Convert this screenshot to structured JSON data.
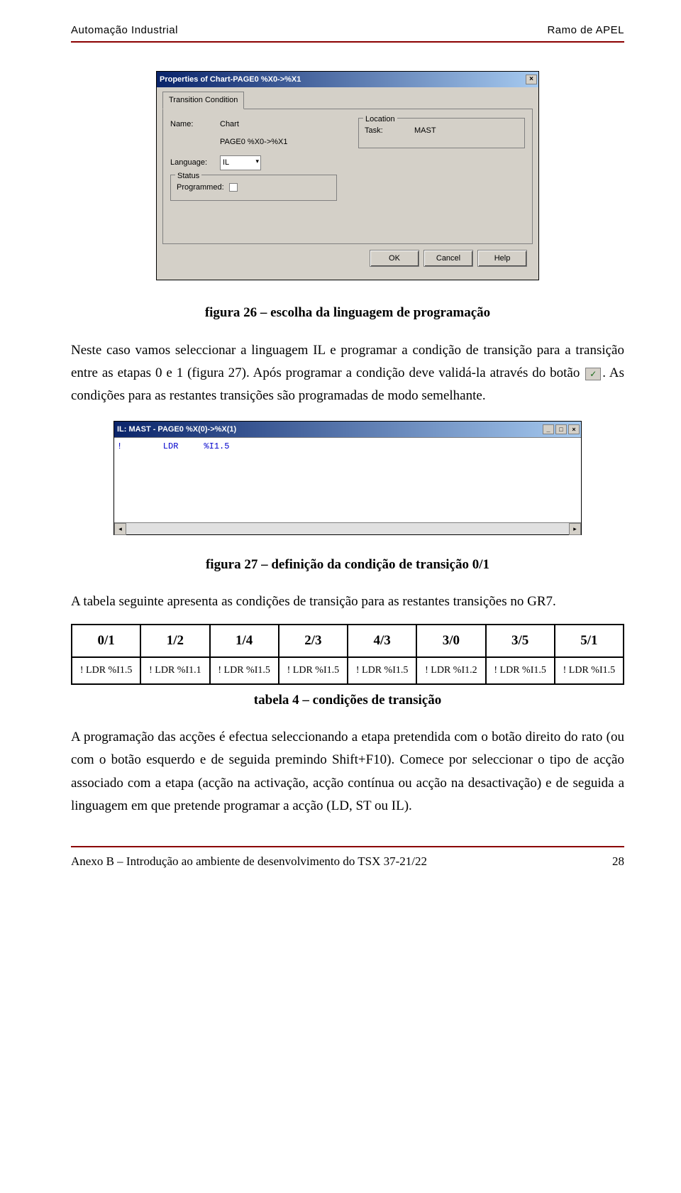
{
  "header": {
    "left": "Automação Industrial",
    "right": "Ramo de APEL"
  },
  "footer": {
    "left": "Anexo B – Introdução ao ambiente de desenvolvimento do TSX 37-21/22",
    "right": "28"
  },
  "dialog": {
    "title": "Properties of Chart-PAGE0 %X0->%X1",
    "tab": "Transition Condition",
    "name_lbl": "Name:",
    "name_val1": "Chart",
    "name_val2": "PAGE0 %X0->%X1",
    "lang_lbl": "Language:",
    "lang_val": "IL",
    "loc_lbl": "Location",
    "task_lbl": "Task:",
    "task_val": "MAST",
    "status_lbl": "Status",
    "prog_lbl": "Programmed:",
    "ok": "OK",
    "cancel": "Cancel",
    "help": "Help"
  },
  "caption1": "figura 26 – escolha da linguagem de programação",
  "para1": "Neste caso vamos seleccionar a linguagem IL e programar a condição de transição para a transição entre as etapas 0 e 1 (figura 27). Após programar a condição deve validá-la através do botão",
  "para1b": ". As condições para as restantes transições são programadas de modo semelhante.",
  "editor": {
    "title": "IL: MAST - PAGE0 %X(0)->%X(1)",
    "code": "!        LDR     %I1.5"
  },
  "caption2": "figura 27 – definição da condição de transição 0/1",
  "para2": "A tabela seguinte apresenta as condições de transição para as restantes transições no GR7.",
  "ttable": {
    "headers": [
      "0/1",
      "1/2",
      "1/4",
      "2/3",
      "4/3",
      "3/0",
      "3/5",
      "5/1"
    ],
    "rows": [
      [
        "! LDR %I1.5",
        "! LDR %I1.1",
        "! LDR %I1.5",
        "! LDR %I1.5",
        "! LDR %I1.5",
        "! LDR %I1.2",
        "! LDR %I1.5",
        "! LDR %I1.5"
      ]
    ]
  },
  "caption3": "tabela 4 – condições de transição",
  "para3": "A programação das acções é efectua seleccionando a etapa pretendida com o botão direito do rato (ou com o botão esquerdo e de seguida premindo Shift+F10). Comece por seleccionar o tipo de acção associado com a etapa (acção na activação, acção contínua ou acção na desactivação) e de seguida a linguagem em que pretende programar a acção (LD, ST ou IL)."
}
